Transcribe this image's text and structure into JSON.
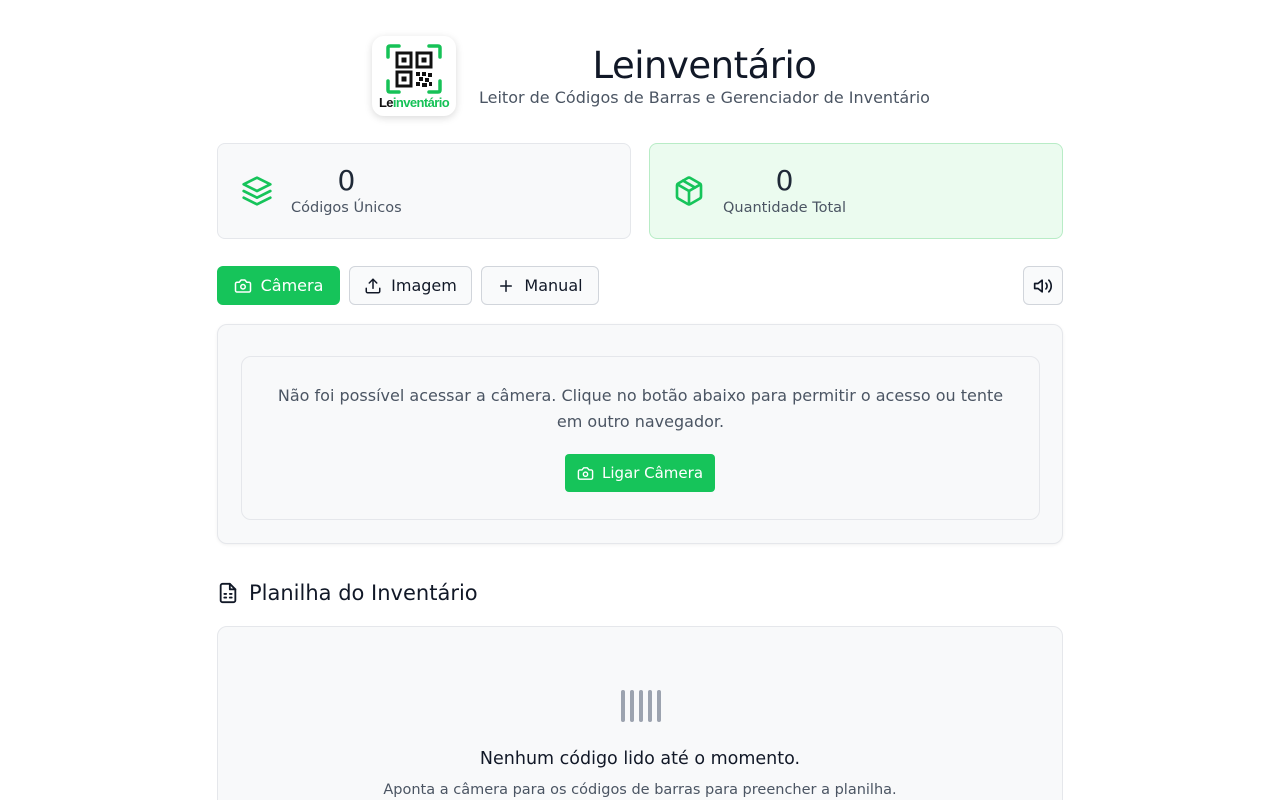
{
  "header": {
    "logo_text_le": "Le",
    "logo_text_inv": "inventário",
    "title": "Leinventário",
    "subtitle": "Leitor de Códigos de Barras e Gerenciador de Inventário"
  },
  "stats": {
    "unique": {
      "value": "0",
      "label": "Códigos Únicos",
      "icon": "layers-icon"
    },
    "total": {
      "value": "0",
      "label": "Quantidade Total",
      "icon": "package-icon"
    }
  },
  "modes": {
    "camera": {
      "label": "Câmera",
      "icon": "camera-icon",
      "active": true
    },
    "image": {
      "label": "Imagem",
      "icon": "upload-icon"
    },
    "manual": {
      "label": "Manual",
      "icon": "plus-icon"
    },
    "sound": {
      "icon": "volume-icon"
    }
  },
  "camera_panel": {
    "message": "Não foi possível acessar a câmera. Clique no botão abaixo para permitir o acesso ou tente em outro navegador.",
    "button_label": "Ligar Câmera"
  },
  "sheet": {
    "title": "Planilha do Inventário",
    "empty_title": "Nenhum código lido até o momento.",
    "empty_hint": "Aponta a câmera para os códigos de barras para preencher a planilha."
  },
  "colors": {
    "accent": "#16c45a",
    "stat_green_bg": "#ebfbef"
  }
}
